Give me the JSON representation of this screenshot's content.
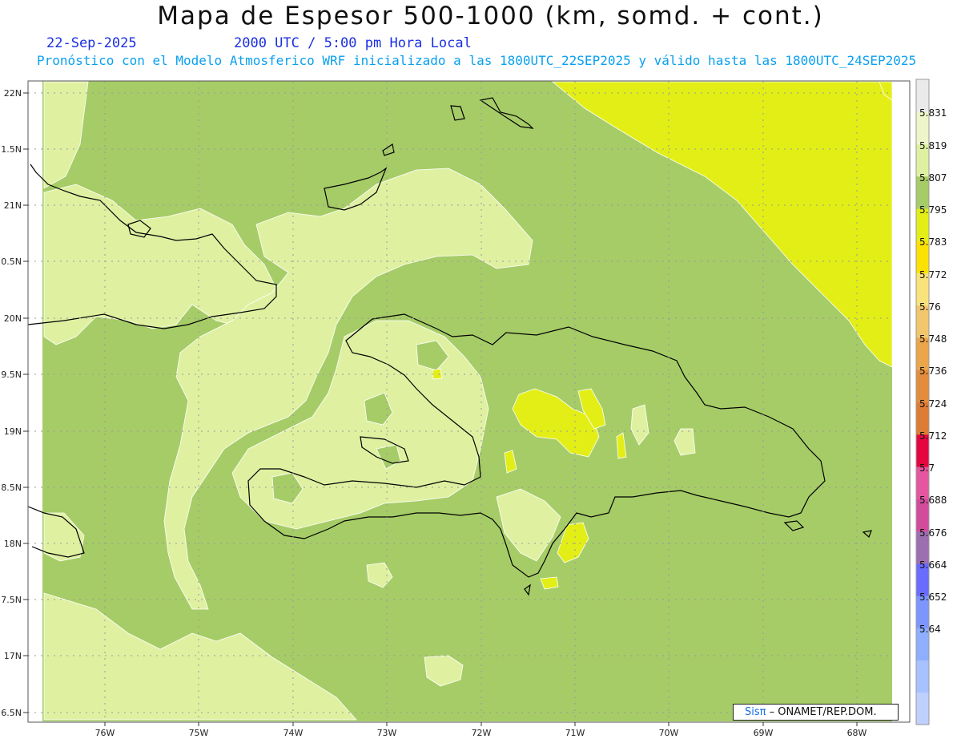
{
  "header": {
    "title": "Mapa de Espesor 500-1000 (km, somd. + cont.)",
    "date": "22-Sep-2025",
    "time": "2000 UTC / 5:00 pm Hora Local",
    "forecast": "Pronóstico con el Modelo Atmosferico WRF inicializado a las 1800UTC_22SEP2025 y válido hasta las  1800UTC_24SEP2025"
  },
  "axes": {
    "lat_labels": [
      "22N",
      "1.5N",
      "21N",
      "0.5N",
      "20N",
      "9.5N",
      "19N",
      "8.5N",
      "18N",
      "7.5N",
      "17N",
      "6.5N"
    ],
    "lon_labels": [
      "76W",
      "75W",
      "74W",
      "73W",
      "72W",
      "71W",
      "70W",
      "69W",
      "68W"
    ]
  },
  "colorbar": {
    "labels": [
      "5.831",
      "5.819",
      "5.807",
      "5.795",
      "5.783",
      "5.772",
      "5.76",
      "5.748",
      "5.736",
      "5.724",
      "5.712",
      "5.7",
      "5.688",
      "5.676",
      "5.664",
      "5.652",
      "5.64"
    ],
    "colors": [
      "#bfd0fe",
      "#a8c1ff",
      "#8faeff",
      "#7d95ff",
      "#6a6bff",
      "#9c6fb0",
      "#d24c9b",
      "#e6559f",
      "#e5063f",
      "#de7b35",
      "#e38c3b",
      "#eba54a",
      "#f1c66d",
      "#f8e37a",
      "#fce200",
      "#e3ee17",
      "#a6cc67",
      "#dff1a1",
      "#eef6c9",
      "#eaeaea"
    ]
  },
  "palette": {
    "band_5795": "#a6cc67",
    "band_5807": "#dff1a1",
    "band_5783": "#e3ee17"
  },
  "credit": {
    "sis": "Sisπ",
    "text": "– ONAMET/REP.DOM."
  }
}
